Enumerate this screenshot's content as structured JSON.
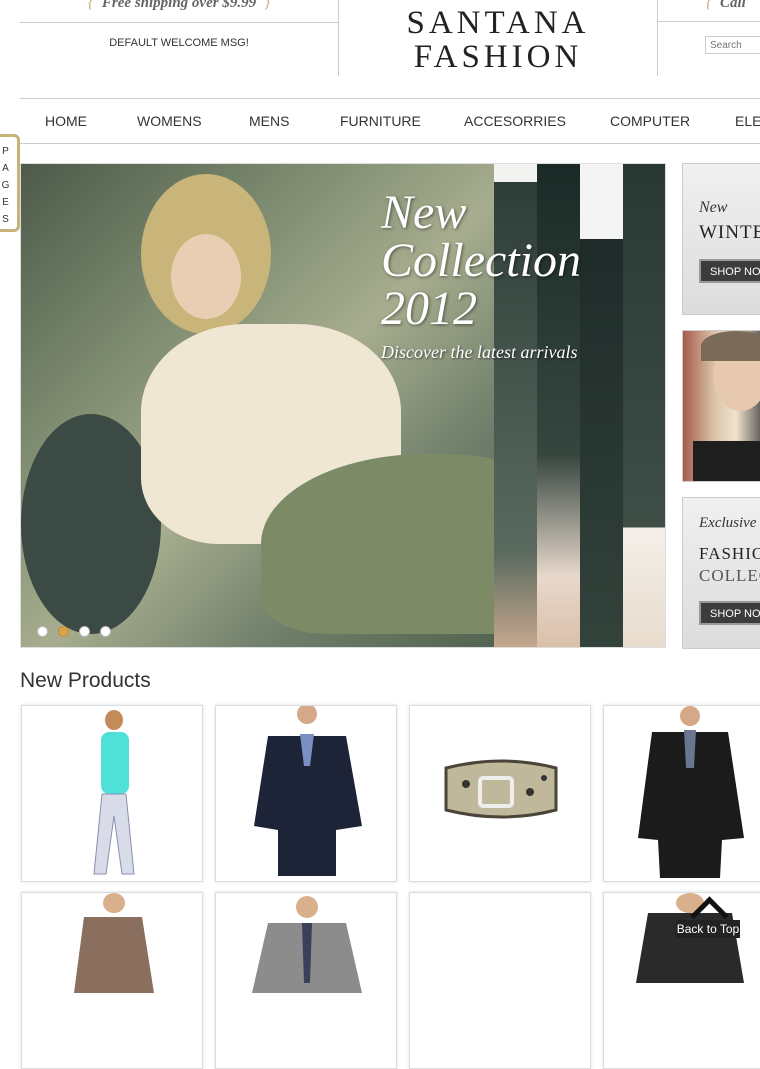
{
  "header": {
    "free_shipping": "Free shipping over $9.99",
    "welcome": "DEFAULT WELCOME MSG!",
    "logo_line1": "SANTANA",
    "logo_line2": "FASHION",
    "call": "Call",
    "search_placeholder": "Search"
  },
  "nav": {
    "items": [
      {
        "label": "HOME"
      },
      {
        "label": "WOMENS"
      },
      {
        "label": "MENS"
      },
      {
        "label": "FURNITURE"
      },
      {
        "label": "ACCESORRIES"
      },
      {
        "label": "COMPUTER"
      },
      {
        "label": "ELE"
      }
    ]
  },
  "pages_tab": {
    "letters": [
      "P",
      "A",
      "G",
      "E",
      "S"
    ]
  },
  "banner": {
    "title_line1": "New",
    "title_line2": "Collection",
    "title_line3": "2012",
    "subtitle": "Discover the latest arrivals",
    "slide_count": 4,
    "active_slide": 2
  },
  "promos": [
    {
      "label": "New",
      "headline": "WINTER",
      "button": "SHOP NOW"
    },
    {
      "label": "",
      "headline": "",
      "button": ""
    },
    {
      "label": "Exclusive",
      "headline": "FASHION",
      "headline2": "COLLECTION",
      "button": "SHOP NOW"
    }
  ],
  "new_products": {
    "title": "New Products",
    "items": [
      {
        "name": "turquoise-top-floral-pants"
      },
      {
        "name": "navy-suit"
      },
      {
        "name": "leopard-belt"
      },
      {
        "name": "black-suit"
      },
      {
        "name": "brown-long-sleeve-top"
      },
      {
        "name": "grey-suit"
      },
      {
        "name": "blank-product"
      },
      {
        "name": "black-off-shoulder-top"
      }
    ]
  },
  "back_to_top": "Back to Top",
  "colors": {
    "accent_gold": "#c5a76a",
    "active_dot": "#d9a24c",
    "button_dark": "#3c3c3c"
  }
}
